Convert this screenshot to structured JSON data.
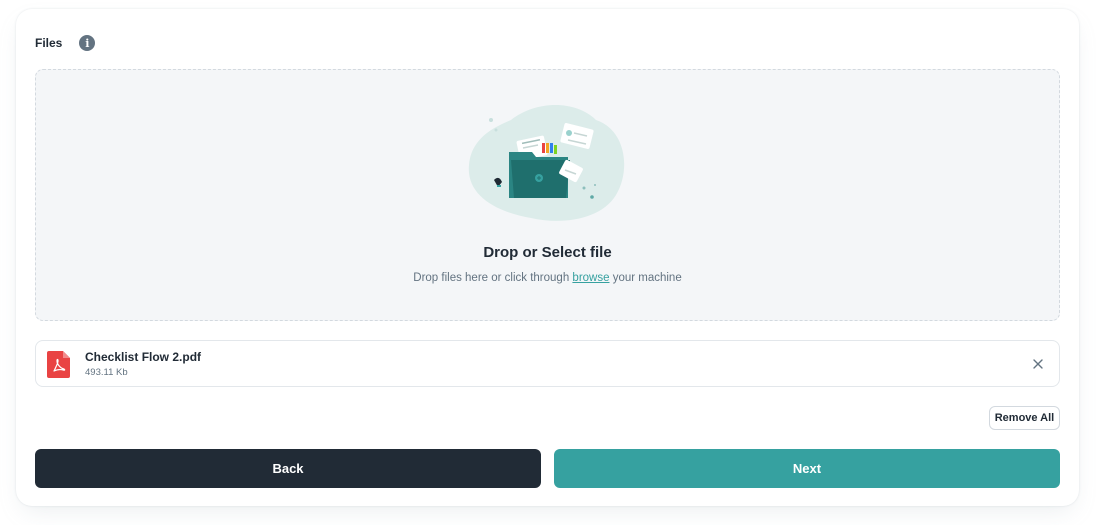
{
  "files_section": {
    "label": "Files",
    "info_icon": "info-icon"
  },
  "dropzone": {
    "title": "Drop or Select file",
    "subtitle_before": "Drop files here or click through ",
    "browse_text": "browse",
    "subtitle_after": " your machine",
    "illustration": "folder-upload-illustration"
  },
  "file_list": [
    {
      "name": "Checklist Flow 2.pdf",
      "size": "493.11 Kb",
      "icon": "pdf-file-icon",
      "remove_icon": "close-icon"
    }
  ],
  "actions": {
    "remove_all_label": "Remove All",
    "back_label": "Back",
    "next_label": "Next"
  },
  "colors": {
    "primary": "#36a1a0",
    "dark": "#212b36",
    "pdf_red": "#e94343",
    "dropzone_bg": "#f4f6f8"
  }
}
